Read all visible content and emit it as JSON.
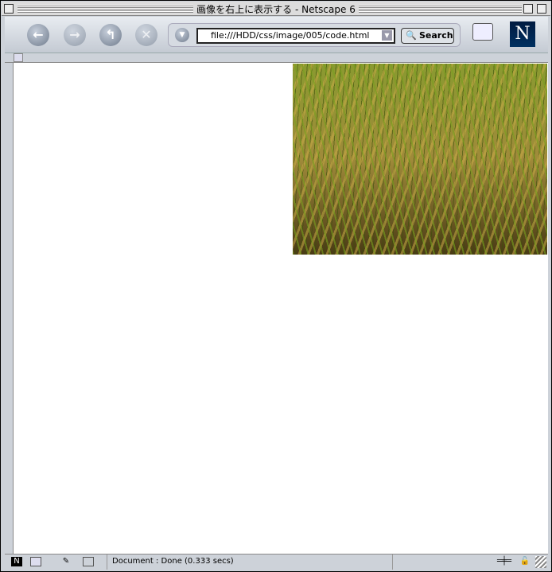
{
  "window": {
    "title": "画像を右上に表示する - Netscape 6"
  },
  "toolbar": {
    "back": "back-icon",
    "forward": "forward-icon",
    "reload": "reload-icon",
    "stop": "stop-icon",
    "url": "file:///HDD/css/image/005/code.html",
    "search_label": "Search",
    "logo_letter": "N"
  },
  "content": {
    "image": "rice-field-photo"
  },
  "status": {
    "text": "Document : Done (0.333 secs)"
  }
}
